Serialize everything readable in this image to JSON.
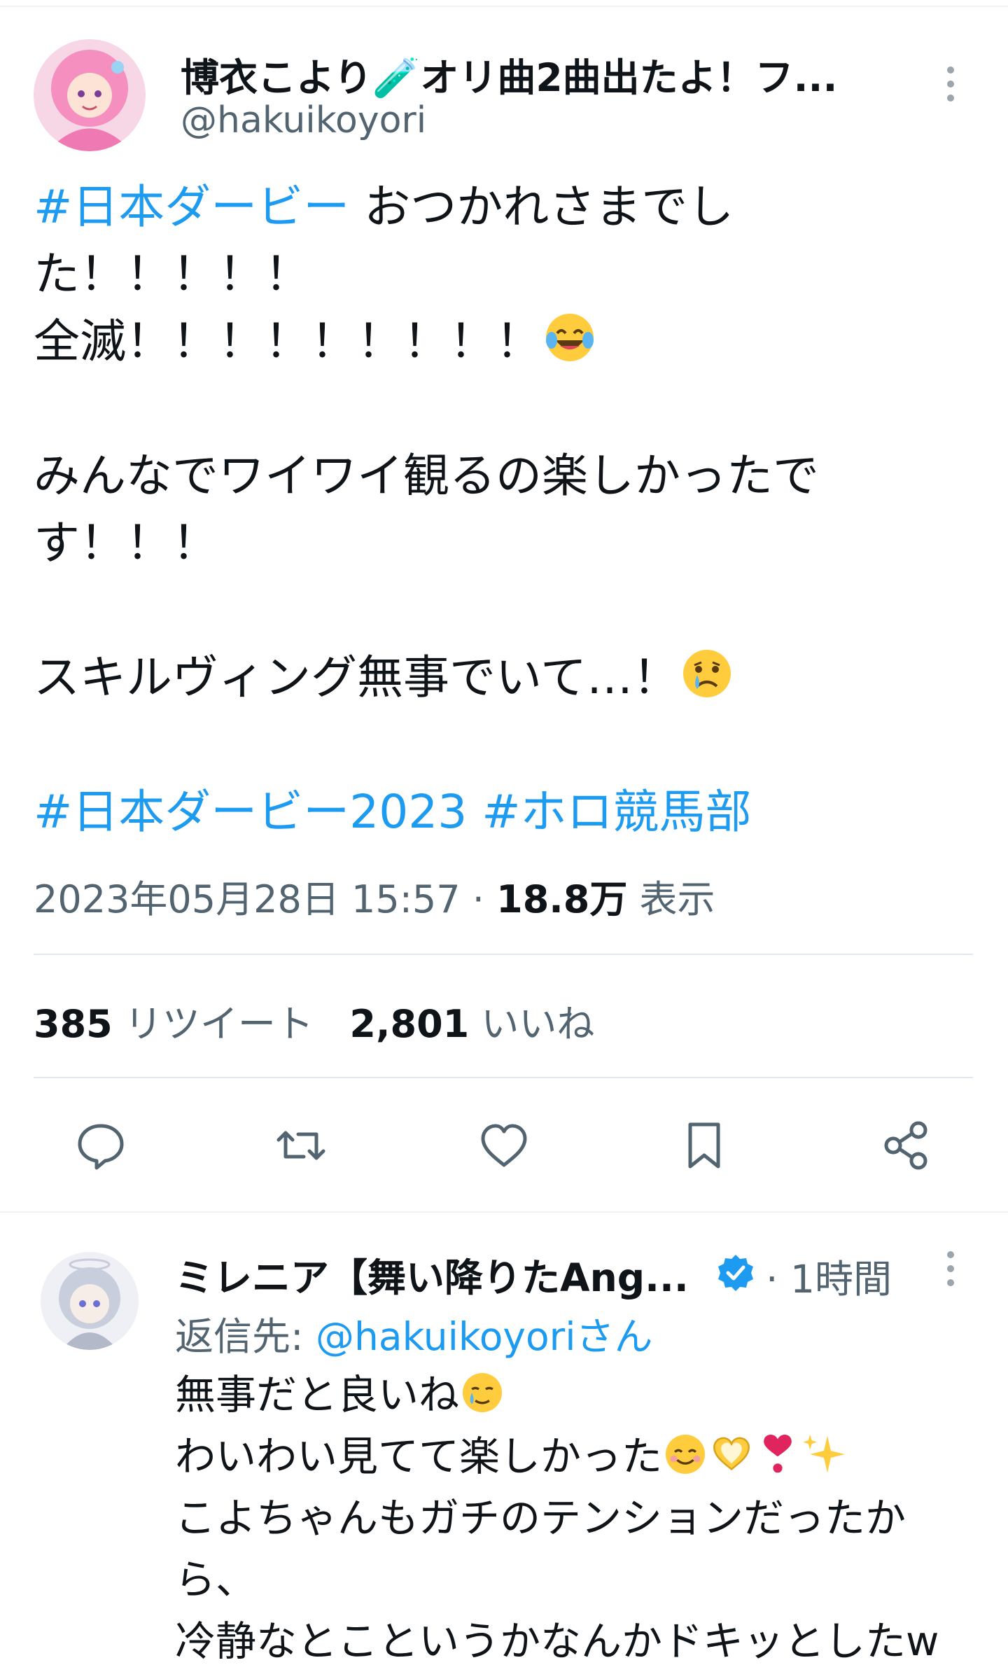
{
  "tweet": {
    "author": {
      "display_name": "博衣こより🧪オリ曲2曲出たよ！フ...",
      "handle": "@hakuikoyori"
    },
    "text_lines": [
      {
        "tag": "#日本ダービー",
        "text": " おつかれさまでし"
      },
      {
        "text": "た！！！！！"
      },
      {
        "text": "全滅！！！！！！！！！",
        "emoji": "face-with-tears-of-joy"
      },
      {
        "text": "みんなでワイワイ観るの楽しかったで"
      },
      {
        "text": "す！！！"
      },
      {
        "text": "スキルヴィング無事でいて…！",
        "emoji": "crying-face"
      }
    ],
    "hashtags": [
      "#日本ダービー2023",
      "#ホロ競馬部"
    ],
    "timestamp": "2023年05月28日 15:57",
    "views_count": "18.8万",
    "views_label": "表示",
    "retweets_count": "385",
    "retweets_label": "リツイート",
    "likes_count": "2,801",
    "likes_label": "いいね"
  },
  "actions": [
    "reply-icon",
    "retweet-icon",
    "like-icon",
    "bookmark-icon",
    "share-icon"
  ],
  "reply": {
    "display_name": "ミレニア【舞い降りたAng...",
    "time": "· 1時間",
    "reply_to_prefix": "返信先: ",
    "reply_to_mention": "@hakuikoyori",
    "reply_to_suffix": "さん",
    "lines": [
      {
        "text": "無事だと良いね",
        "emojis": [
          "face-holding-back-tears"
        ]
      },
      {
        "text": "わいわい見てて楽しかった",
        "emojis": [
          "smiling-face",
          "heart-hands",
          "red-heart-exclamation",
          "sparkles"
        ]
      },
      {
        "text": "こよちゃんもガチのテンションだったか"
      },
      {
        "text": "ら、"
      },
      {
        "text": "冷静なとこというかなんかドキッとしたw"
      }
    ]
  },
  "colors": {
    "link": "#1d9bf0",
    "secondary": "#536471",
    "text": "#0f1419",
    "divider": "#e1e8ed"
  }
}
